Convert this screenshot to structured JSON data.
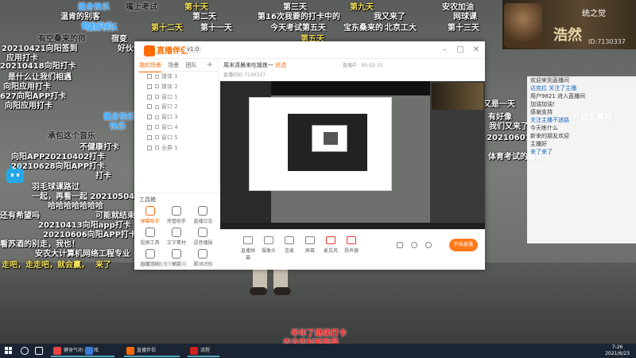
{
  "danmaku": [
    {
      "text": "健身快乐",
      "color": "blue"
    },
    {
      "text": "嘴上考试",
      "color": "black"
    },
    {
      "text": "第十天",
      "color": "yellow"
    },
    {
      "text": "第三天",
      "color": "white"
    },
    {
      "text": "第九天",
      "color": "yellow"
    },
    {
      "text": "安农加油",
      "color": "white"
    },
    {
      "text": "温肯的别客",
      "color": "white"
    },
    {
      "text": "健身快乐",
      "color": "blue"
    },
    {
      "text": "第二天",
      "color": "white"
    },
    {
      "text": "第16次我要的打卡中的",
      "color": "white"
    },
    {
      "text": "我又来了",
      "color": "white"
    },
    {
      "text": "网球课",
      "color": "white"
    },
    {
      "text": "健身快乐",
      "color": "blue"
    },
    {
      "text": "第十二天",
      "color": "yellow"
    },
    {
      "text": "第十一天",
      "color": "white"
    },
    {
      "text": "今天考试第五天",
      "color": "white"
    },
    {
      "text": "宝东桑来的",
      "color": "white"
    },
    {
      "text": "北京工大",
      "color": "white"
    },
    {
      "text": "第十三天",
      "color": "white"
    },
    {
      "text": "有空桑来的师",
      "color": "black"
    },
    {
      "text": "宿变",
      "color": "white"
    },
    {
      "text": "第五天",
      "color": "yellow"
    },
    {
      "text": "20210421向阳签到",
      "color": "white"
    },
    {
      "text": "应用打卡",
      "color": "white"
    },
    {
      "text": "好伙伴打卡！",
      "color": "white"
    },
    {
      "text": "20210418向阳打卡",
      "color": "white"
    },
    {
      "text": "是什么让我们相遇",
      "color": "white"
    },
    {
      "text": "向阳应用打卡",
      "color": "white"
    },
    {
      "text": "627向阳APP打卡",
      "color": "white"
    },
    {
      "text": "向阳应用打卡",
      "color": "white"
    },
    {
      "text": "健身快乐",
      "color": "blue"
    },
    {
      "text": "快乐",
      "color": "blue"
    },
    {
      "text": "承包这个音乐",
      "color": "black"
    },
    {
      "text": "不健康打卡",
      "color": "white"
    },
    {
      "text": "向阳APP20210402打卡",
      "color": "white"
    },
    {
      "text": "20210628向阳APP打卡",
      "color": "white"
    },
    {
      "text": "打卡",
      "color": "white"
    },
    {
      "text": "羽毛球课路过",
      "color": "white"
    },
    {
      "text": "一起，再看一起 20210504",
      "color": "white"
    },
    {
      "text": "哈哈哈哈哈哈哈",
      "color": "white"
    },
    {
      "text": "还有希望吗",
      "color": "white"
    },
    {
      "text": "可能就结束了",
      "color": "white"
    },
    {
      "text": "20210413向阳app打卡",
      "color": "white"
    },
    {
      "text": "20210606向阳APP打卡",
      "color": "white"
    },
    {
      "text": "看苏酒的别走，我也！",
      "color": "white"
    },
    {
      "text": "安农大计算机网络工程专业",
      "color": "white"
    },
    {
      "text": "走吧，走走吧，就会赢，",
      "color": "yellow"
    },
    {
      "text": "来了",
      "color": "yellow"
    },
    {
      "text": "又是一天",
      "color": "white"
    },
    {
      "text": "有好像",
      "color": "white"
    },
    {
      "text": "我们又来了",
      "color": "white"
    },
    {
      "text": "20210601向阳打卡",
      "color": "white"
    },
    {
      "text": "体育考试的看见",
      "color": "white"
    },
    {
      "text": "开启五禽戏",
      "color": "white"
    },
    {
      "text": "半年了继续打卡",
      "color": "red"
    },
    {
      "text": "农业农村部指导",
      "color": "red"
    }
  ],
  "banner": {
    "title": "浩然",
    "tag": "统之觉",
    "id": "ID:7130337"
  },
  "app": {
    "logo": "直播伴侣",
    "version": "v1.0",
    "window_controls": [
      "–",
      "□",
      "✕"
    ],
    "scene_tabs": [
      {
        "label": "我的场景",
        "active": true
      },
      {
        "label": "场景",
        "active": false
      },
      {
        "label": "团队",
        "active": false
      }
    ],
    "scene_tab_add": "+",
    "sources": [
      "媒体 1",
      "媒体 2",
      "窗口 1",
      "窗口 2",
      "窗口 3",
      "窗口 4",
      "窗口 5",
      "全屏 1"
    ],
    "toolbox_title": "工具箱",
    "tools": [
      {
        "label": "弹幕助手",
        "active": true
      },
      {
        "label": "房管助手",
        "active": false
      },
      {
        "label": "直播日志",
        "active": false
      },
      {
        "label": "投屏工具",
        "active": false
      },
      {
        "label": "文字素材",
        "active": false
      },
      {
        "label": "语音播报",
        "active": false
      },
      {
        "label": "直播连线",
        "active": false
      },
      {
        "label": "抽奖",
        "active": false
      },
      {
        "label": "歌词识别",
        "active": false
      }
    ],
    "toolbox_tip": "点击了解直播伴侣功能",
    "room_title": "周末清晨来吃锻炼一",
    "room_tag": "优选",
    "room_sub": "直播间ID  7130337",
    "room_info": "· 直播中 · 00:02:15",
    "controls": [
      {
        "label": "直播弹幕",
        "red": false
      },
      {
        "label": "摄像头",
        "red": false
      },
      {
        "label": "连麦",
        "red": false
      },
      {
        "label": "屏幕",
        "red": false
      },
      {
        "label": "麦克风",
        "red": true
      },
      {
        "label": "扬声器",
        "red": true
      }
    ],
    "go_live": "开始直播"
  },
  "chat": [
    {
      "text": "欢迎来到直播间",
      "blue": false
    },
    {
      "text": "达克拉 关注了主播",
      "blue": true
    },
    {
      "text": "用户9821 进入直播间",
      "blue": false
    },
    {
      "text": "加油加油！",
      "blue": false
    },
    {
      "text": "感谢支持",
      "blue": false
    },
    {
      "text": "关注主播不迷路",
      "blue": true
    },
    {
      "text": "今天练什么",
      "blue": false
    },
    {
      "text": "新来的朋友欢迎",
      "blue": false
    },
    {
      "text": "主播好",
      "blue": false
    },
    {
      "text": "来了来了",
      "blue": true
    }
  ],
  "taskbar": {
    "items": [
      {
        "label": "健身气功·五禽戏",
        "icon_color": "#e44"
      },
      {
        "label": "",
        "icon_color": "#3a7bd5"
      },
      {
        "label": "直播伴侣",
        "icon_color": "#ff6a00"
      },
      {
        "label": "流程",
        "icon_color": "#c22"
      }
    ],
    "time": "7:26",
    "date": "2021/6/23"
  }
}
